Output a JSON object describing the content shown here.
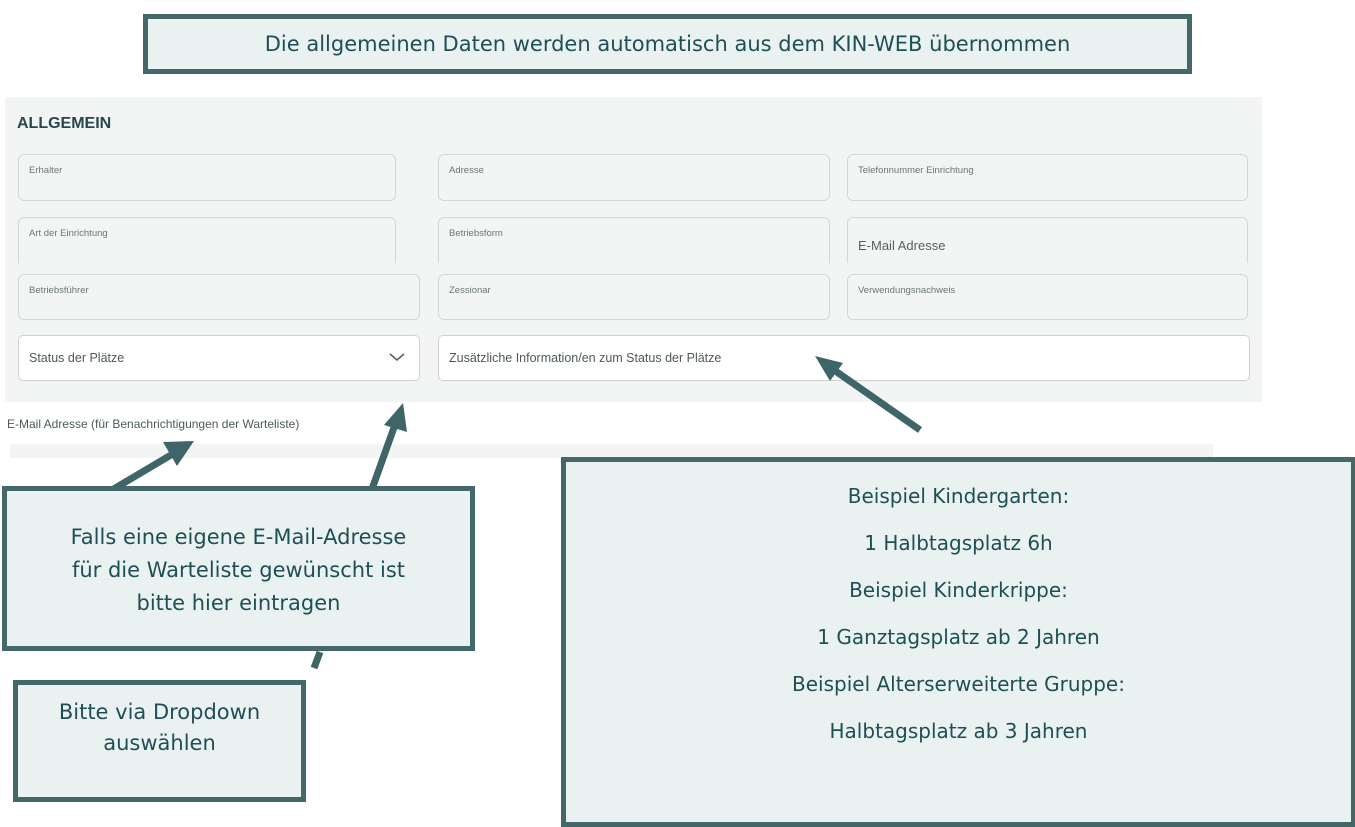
{
  "top_callout": "Die allgemeinen Daten werden automatisch aus dem KIN-WEB übernommen",
  "panel": {
    "title": "ALLGEMEIN",
    "fields": {
      "erhalter": "Erhalter",
      "adresse": "Adresse",
      "telefon": "Telefonnummer Einrichtung",
      "art": "Art der Einrichtung",
      "betriebsform": "Betriebsform",
      "email": "E-Mail Adresse",
      "betriebsfuehrer": "Betriebsführer",
      "zessionar": "Zessionar",
      "verwendungsnachweis": "Verwendungsnachweis"
    },
    "status_select": "Status der Plätze",
    "status_info_placeholder": "Zusätzliche Information/en zum Status der Plätze"
  },
  "email_note": "E-Mail Adresse (für Benachrichtigungen der Warteliste)",
  "warteliste_callout": [
    "Falls eine eigene E-Mail-Adresse",
    "für die Warteliste gewünscht ist",
    "bitte hier eintragen"
  ],
  "dropdown_callout": [
    "Bitte via Dropdown",
    "auswählen"
  ],
  "example_callout": [
    "Beispiel Kindergarten:",
    "1 Halbtagsplatz 6h",
    "Beispiel Kinderkrippe:",
    "1 Ganztagsplatz ab 2 Jahren",
    "Beispiel Alterserweiterte Gruppe:",
    "Halbtagsplatz ab 3 Jahren"
  ],
  "colors": {
    "callout_border": "#44676a",
    "callout_bg": "#e9f2f1",
    "callout_text": "#1f4f56",
    "panel_bg": "#f3f4f4"
  },
  "icons": {
    "select_chevron": "chevron-down-icon",
    "arrows": "arrow-icon"
  }
}
